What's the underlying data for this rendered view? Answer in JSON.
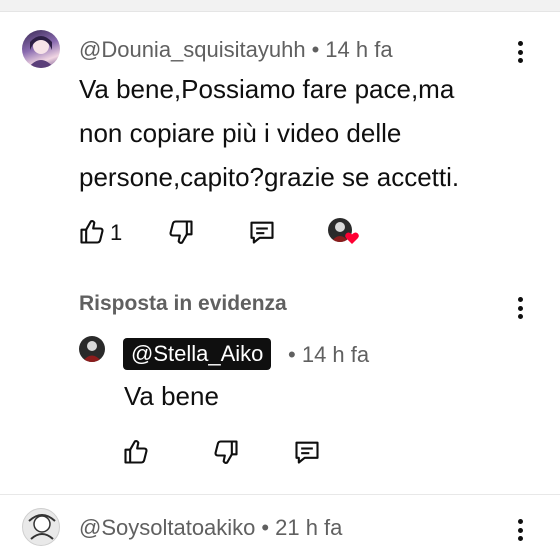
{
  "comment1": {
    "author": "@Dounia_squisitayuhh",
    "separator": "•",
    "time": "14 h fa",
    "lines": [
      "Va bene,Possiamo fare pace,ma",
      "non copiare più i video delle",
      "persone,capito?grazie se accetti."
    ],
    "like_count": "1"
  },
  "highlight": {
    "label": "Risposta in evidenza"
  },
  "reply": {
    "author": "@Stella_Aiko",
    "separator": "•",
    "time": "14 h fa",
    "text": "Va bene"
  },
  "comment2": {
    "author": "@Soysoltatoakiko",
    "separator": "•",
    "time": "21 h fa"
  },
  "colors": {
    "meta": "#606060",
    "text": "#0f0f0f",
    "heart": "#ff0033"
  }
}
